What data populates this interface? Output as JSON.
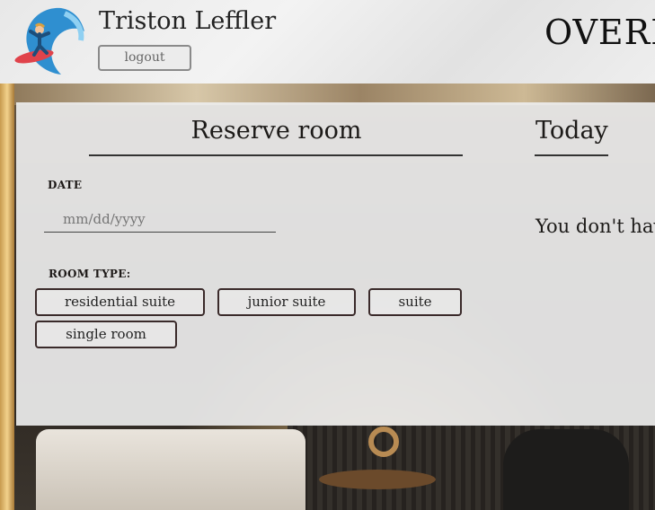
{
  "header": {
    "user_name": "Triston Leffler",
    "logout_label": "logout",
    "brand": "OVERL"
  },
  "reserve": {
    "title": "Reserve room",
    "date_label": "DATE",
    "date_placeholder": "mm/dd/yyyy",
    "room_type_label": "ROOM TYPE:",
    "room_types": [
      "residential suite",
      "junior suite",
      "suite",
      "single room"
    ]
  },
  "today": {
    "title": "Today",
    "message": "You don't hav"
  },
  "colors": {
    "panel_bg": "#ececec",
    "button_border": "#3a2a2a",
    "text": "#1c1a18"
  },
  "icons": {
    "avatar": "surfer-wave-icon"
  }
}
